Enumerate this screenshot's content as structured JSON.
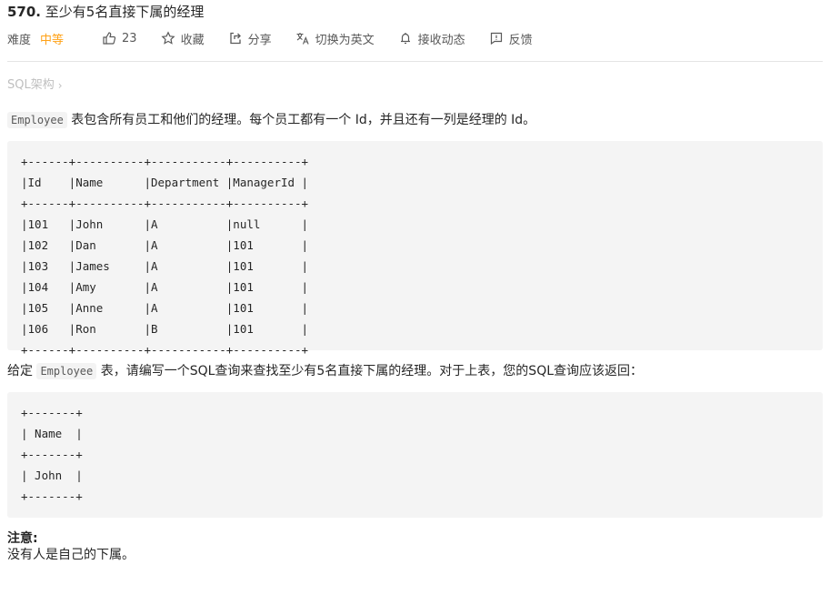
{
  "problem": {
    "number": "570.",
    "title": "至少有5名直接下属的经理"
  },
  "meta": {
    "difficulty_label": "难度",
    "difficulty_value": "中等",
    "difficulty_color": "#ffa116",
    "likes": "23",
    "favorite_label": "收藏",
    "share_label": "分享",
    "translate_label": "切换为英文",
    "subscribe_label": "接收动态",
    "feedback_label": "反馈"
  },
  "breadcrumb": {
    "label": "SQL架构",
    "chevron": "›"
  },
  "description": {
    "intro_code": "Employee",
    "intro_text": " 表包含所有员工和他们的经理。每个员工都有一个 Id，并且还有一列是经理的 Id。",
    "input_table": "+------+----------+-----------+----------+\n|Id    |Name      |Department |ManagerId |\n+------+----------+-----------+----------+\n|101   |John      |A          |null      |\n|102   |Dan       |A          |101       |\n|103   |James     |A          |101       |\n|104   |Amy       |A          |101       |\n|105   |Anne      |A          |101       |\n|106   |Ron       |B          |101       |\n+------+----------+-----------+----------+",
    "question_prefix": "给定 ",
    "question_code": "Employee",
    "question_text": " 表，请编写一个SQL查询来查找至少有5名直接下属的经理。对于上表，您的SQL查询应该返回：",
    "output_table": "+-------+\n| Name  |\n+-------+\n| John  |\n+-------+",
    "note_title": "注意:",
    "note_text": "没有人是自己的下属。"
  }
}
